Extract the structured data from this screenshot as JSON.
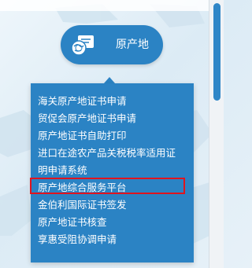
{
  "button": {
    "label": "原产地",
    "icon": "globe-certificate-icon"
  },
  "menu": {
    "items": [
      "海关原产地证书申请",
      "贸促会原产地证书申请",
      "原产地证书自助打印",
      "进口在途农产品关税税率适用证",
      "明申请系统",
      "原产地综合服务平台",
      "金伯利国际证书签发",
      "原产地证书核查",
      "享惠受阻协调申请"
    ],
    "highlighted_item": "原产地综合服务平台"
  },
  "colors": {
    "accent": "#2b83c4",
    "highlight_border": "#e0141e"
  }
}
